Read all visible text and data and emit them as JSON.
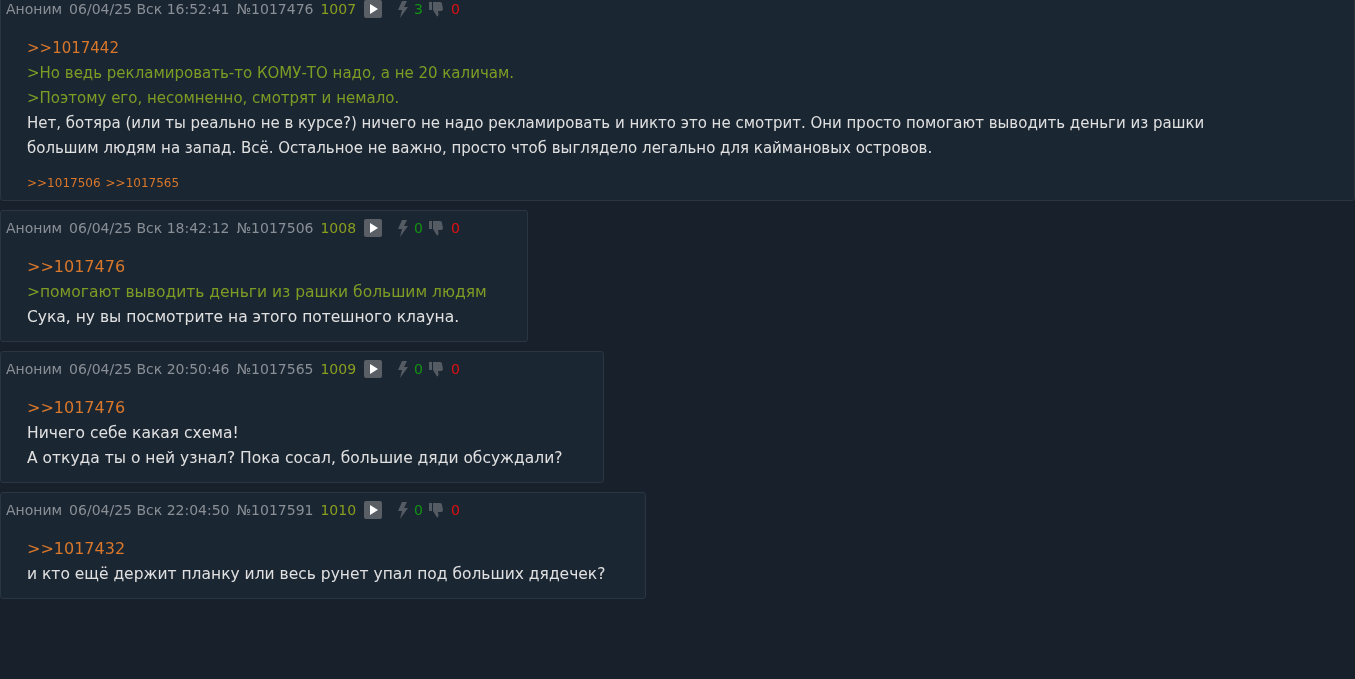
{
  "posts": [
    {
      "author": "Аноним",
      "date": "06/04/25 Вск 16:52:41",
      "number": "№1017476",
      "ordinal": "1007",
      "likes": "3",
      "dislikes": "0",
      "lines": [
        {
          "kind": "reply",
          "text": ">>1017442"
        },
        {
          "kind": "quote",
          "text": ">Но ведь рекламировать-то КОМУ-ТО надо, а не 20 каличам."
        },
        {
          "kind": "quote",
          "text": ">Поэтому его, несомненно, смотрят и немало."
        },
        {
          "kind": "text",
          "text": "Нет, ботяра (или ты реально не в курсе?) ничего не надо рекламировать и никто это не смотрит. Они просто помогают выводить деньги из рашки"
        },
        {
          "kind": "text",
          "text": "большим людям на запад. Всё. Остальное не важно, просто чтоб выглядело легально для каймановых островов."
        }
      ],
      "replies": [
        ">>1017506",
        ">>1017565"
      ]
    },
    {
      "author": "Аноним",
      "date": "06/04/25 Вск 18:42:12",
      "number": "№1017506",
      "ordinal": "1008",
      "likes": "0",
      "dislikes": "0",
      "lines": [
        {
          "kind": "reply",
          "text": ">>1017476"
        },
        {
          "kind": "quote",
          "text": ">помогают выводить деньги из рашки большим людям"
        },
        {
          "kind": "text",
          "text": "Сука, ну вы посмотрите на этого потешного клауна."
        }
      ]
    },
    {
      "author": "Аноним",
      "date": "06/04/25 Вск 20:50:46",
      "number": "№1017565",
      "ordinal": "1009",
      "likes": "0",
      "dislikes": "0",
      "lines": [
        {
          "kind": "reply",
          "text": ">>1017476"
        },
        {
          "kind": "text",
          "text": "Ничего себе какая схема!"
        },
        {
          "kind": "text",
          "text": "А откуда ты о ней узнал? Пока сосал, большие дяди обсуждали?"
        }
      ]
    },
    {
      "author": "Аноним",
      "date": "06/04/25 Вск 22:04:50",
      "number": "№1017591",
      "ordinal": "1010",
      "likes": "0",
      "dislikes": "0",
      "lines": [
        {
          "kind": "reply",
          "text": ">>1017432"
        },
        {
          "kind": "text",
          "text": "и кто ещё держит планку или весь рунет упал под больших дядечек?"
        }
      ]
    }
  ]
}
